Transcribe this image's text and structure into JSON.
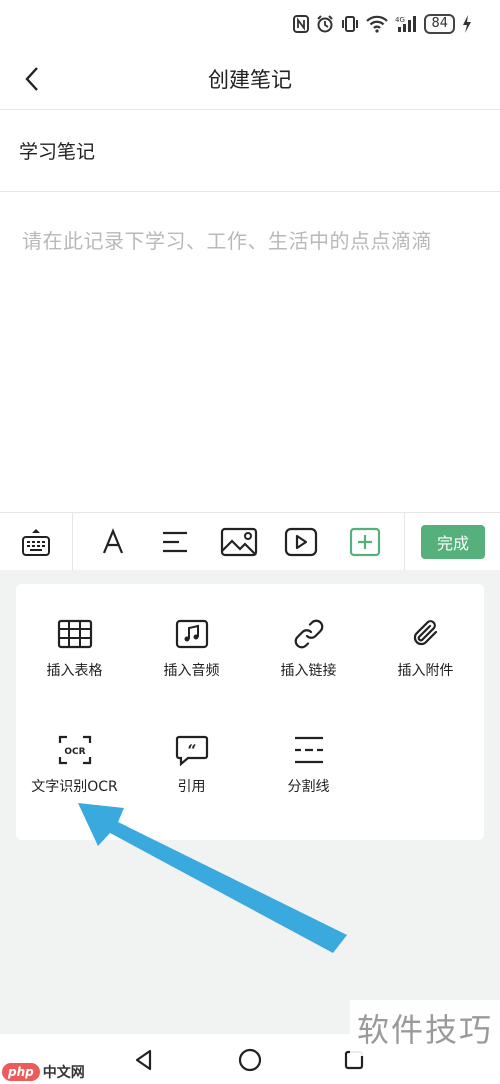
{
  "status_bar": {
    "battery": "84",
    "network": "4G"
  },
  "header": {
    "title": "创建笔记"
  },
  "note": {
    "title": "学习笔记",
    "content_placeholder": "请在此记录下学习、工作、生活中的点点滴滴"
  },
  "toolbar": {
    "done_label": "完成",
    "accent_color": "#55b07c"
  },
  "insert_panel": {
    "items": [
      {
        "label": "插入表格",
        "icon": "table-icon"
      },
      {
        "label": "插入音频",
        "icon": "music-icon"
      },
      {
        "label": "插入链接",
        "icon": "link-icon"
      },
      {
        "label": "插入附件",
        "icon": "paperclip-icon"
      },
      {
        "label": "文字识别OCR",
        "icon": "ocr-icon"
      },
      {
        "label": "引用",
        "icon": "quote-icon"
      },
      {
        "label": "分割线",
        "icon": "divider-icon"
      }
    ]
  },
  "watermark": {
    "right_text": "软件技巧",
    "php_badge": "php",
    "site_text": "中文网"
  },
  "annotation": {
    "arrow_color": "#3aa9de"
  }
}
